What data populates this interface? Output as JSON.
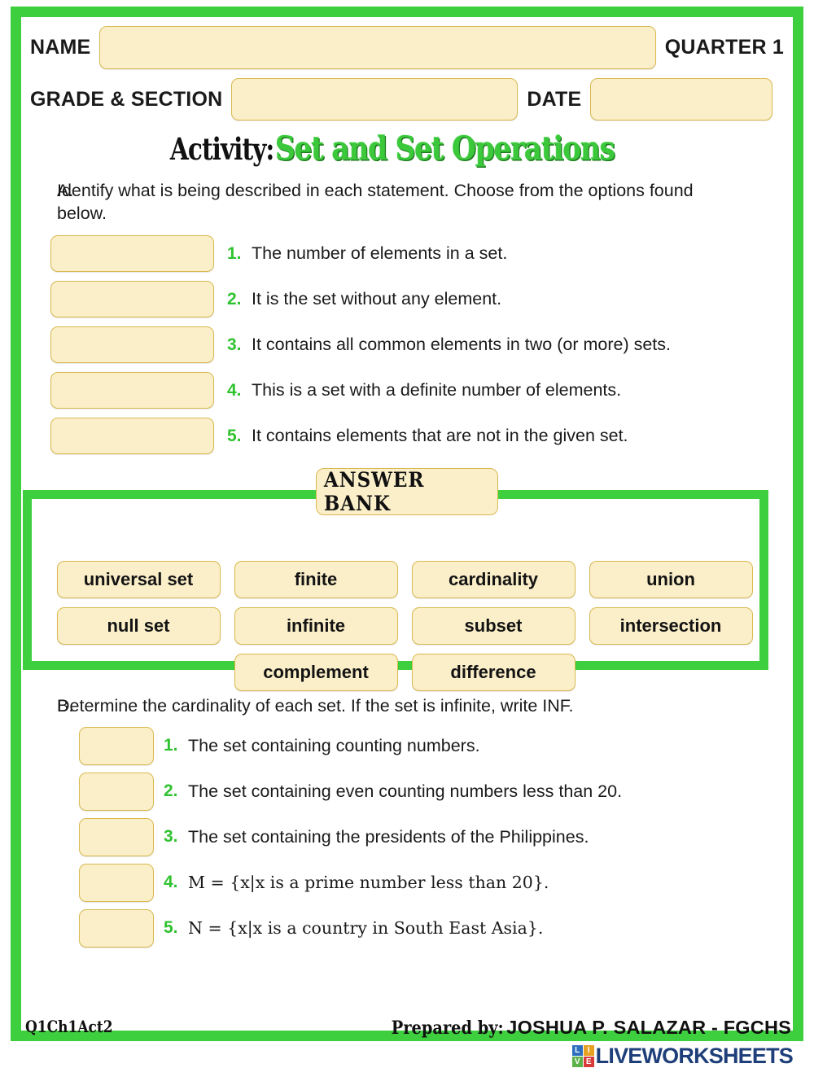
{
  "header": {
    "name_label": "NAME",
    "quarter_label": "QUARTER 1",
    "grade_section_label": "GRADE & SECTION",
    "date_label": "DATE",
    "name_value": "",
    "grade_section_value": "",
    "date_value": ""
  },
  "title": {
    "prefix": "Activity:",
    "main": "Set and Set Operations",
    "accent_color": "#3BC93B"
  },
  "section_a": {
    "letter": "A.",
    "instruction": "Identify what is being described in each statement. Choose from the options found below.",
    "items": [
      {
        "num": "1.",
        "text": "The number of elements in a set.",
        "answer": ""
      },
      {
        "num": "2.",
        "text": "It is the set without any element.",
        "answer": ""
      },
      {
        "num": "3.",
        "text": "It contains all common elements in two (or more) sets.",
        "answer": ""
      },
      {
        "num": "4.",
        "text": "This is a set with a definite number of elements.",
        "answer": ""
      },
      {
        "num": "5.",
        "text": "It contains elements that are not in the given set.",
        "answer": ""
      }
    ]
  },
  "answer_bank": {
    "title": "ANSWER BANK",
    "rows": [
      [
        "universal set",
        "finite",
        "cardinality",
        "union"
      ],
      [
        "null set",
        "infinite",
        "subset",
        "intersection"
      ],
      [
        "",
        "complement",
        "difference",
        ""
      ]
    ]
  },
  "section_b": {
    "letter": "B.",
    "instruction": "Determine the cardinality of each set. If the set is infinite, write INF.",
    "items": [
      {
        "num": "1.",
        "text": "The set containing counting numbers.",
        "answer": ""
      },
      {
        "num": "2.",
        "text": "The set containing even counting numbers less than 20.",
        "answer": ""
      },
      {
        "num": "3.",
        "text": "The set containing the presidents of the Philippines.",
        "answer": ""
      },
      {
        "num": "4.",
        "text": "M = {x|x is a prime number less than 20}.",
        "answer": ""
      },
      {
        "num": "5.",
        "text": "N = {x|x is a country in South East Asia}.",
        "answer": ""
      }
    ]
  },
  "footer": {
    "code": "Q1Ch1Act2",
    "prepared_label": "Prepared by:",
    "prepared_name": "JOSHUA P. SALAZAR - FGCHS",
    "watermark": "LIVEWORKSHEETS",
    "watermark_squares": [
      "L",
      "I",
      "V",
      "E"
    ]
  },
  "theme": {
    "green": "#3ECF3E",
    "number_green": "#2FC22F",
    "box_fill": "#FBEFC9",
    "box_border": "#D9B94F",
    "logo_blue": "#1F3F7A"
  }
}
